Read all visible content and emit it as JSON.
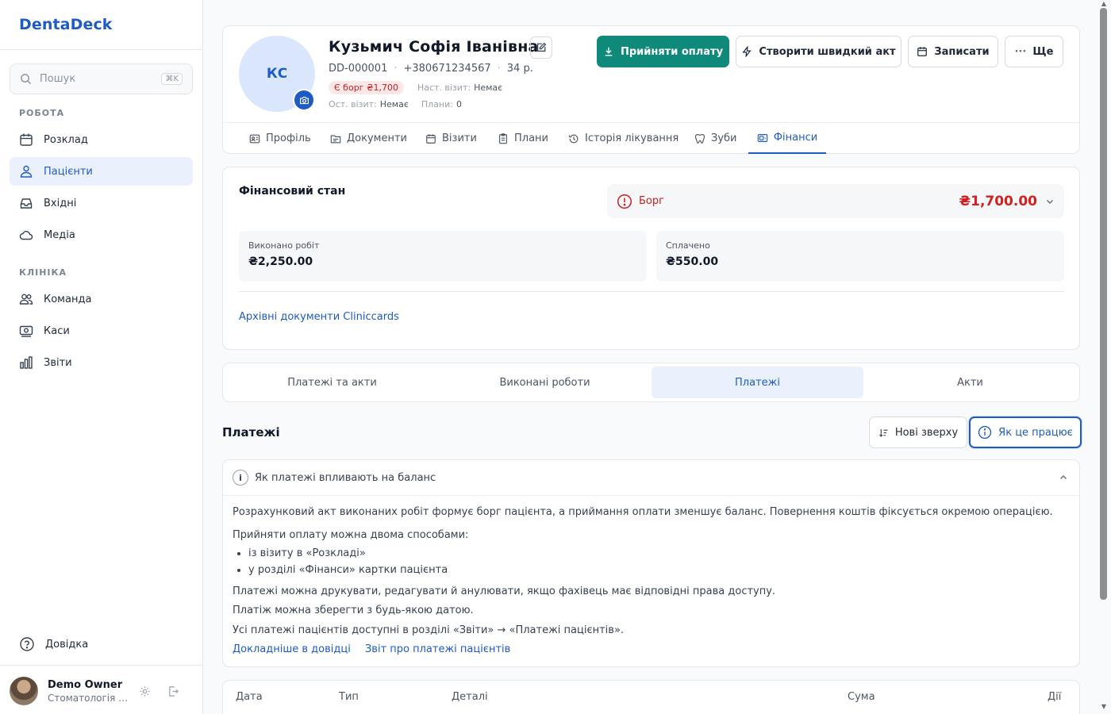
{
  "app": {
    "name": "DentaDeck"
  },
  "search": {
    "placeholder": "Пошук",
    "shortcut": "⌘K"
  },
  "sidebar": {
    "section_work": "РОБОТА",
    "section_clinic": "КЛІНІКА",
    "work_items": [
      {
        "label": "Розклад",
        "icon": "calendar-icon"
      },
      {
        "label": "Пацієнти",
        "icon": "patients-icon",
        "active": true
      },
      {
        "label": "Вхідні",
        "icon": "inbox-icon"
      },
      {
        "label": "Медіа",
        "icon": "cloud-icon"
      }
    ],
    "clinic_items": [
      {
        "label": "Команда",
        "icon": "team-icon"
      },
      {
        "label": "Каси",
        "icon": "cash-icon"
      },
      {
        "label": "Звіти",
        "icon": "reports-icon"
      }
    ],
    "help_label": "Довідка",
    "user": {
      "name": "Demo Owner",
      "org": "Стоматологія П..."
    }
  },
  "patient": {
    "initials": "КС",
    "name": "Кузьмич Софія Іванівна",
    "id": "DD-000001",
    "phone": "+380671234567",
    "age": "34 р.",
    "debt_badge": "Є борг ₴1,700",
    "next_visit_label": "Наст. візит:",
    "next_visit_value": "Немає",
    "last_visit_label": "Ост. візит:",
    "last_visit_value": "Немає",
    "plans_label": "Плани:",
    "plans_value": "0"
  },
  "actions": {
    "accept_payment": "Прийняти оплату",
    "quick_act": "Створити швидкий акт",
    "book": "Записати",
    "more": "Ще"
  },
  "tabs": [
    {
      "label": "Профіль",
      "icon": "profile-icon"
    },
    {
      "label": "Документи",
      "icon": "documents-icon"
    },
    {
      "label": "Візити",
      "icon": "visits-icon"
    },
    {
      "label": "Плани",
      "icon": "plans-icon"
    },
    {
      "label": "Історія лікування",
      "icon": "history-icon"
    },
    {
      "label": "Зуби",
      "icon": "tooth-icon"
    },
    {
      "label": "Фінанси",
      "icon": "finance-icon",
      "active": true
    }
  ],
  "finance": {
    "title": "Фінансовий стан",
    "debt_label": "Борг",
    "debt_amount": "₴1,700.00",
    "works_label": "Виконано робіт",
    "works_value": "₴2,250.00",
    "paid_label": "Сплачено",
    "paid_value": "₴550.00",
    "archive_link": "Архівні документи Cliniccards"
  },
  "segments": [
    {
      "label": "Платежі та акти"
    },
    {
      "label": "Виконані роботи"
    },
    {
      "label": "Платежі",
      "active": true
    },
    {
      "label": "Акти"
    }
  ],
  "payments": {
    "title": "Платежі",
    "sort_label": "Нові зверху",
    "how_label": "Як це працює"
  },
  "info": {
    "title": "Як платежі впливають на баланс",
    "p1": "Розрахунковий акт виконаних робіт формує борг пацієнта, а приймання оплати зменшує баланс. Повернення коштів фіксується окремою операцією.",
    "p2": "Прийняти оплату можна двома способами:",
    "li1": "із візиту в «Розкладі»",
    "li2": "у розділі «Фінанси» картки пацієнта",
    "p3": "Платежі можна друкувати, редагувати й анулювати, якщо фахівець має відповідні права доступу.",
    "p4": "Платіж можна зберегти з будь-якою датою.",
    "p5": "Усі платежі пацієнтів доступні в розділі «Звіти» → «Платежі пацієнтів».",
    "link1": "Докладніше в довідці",
    "link2": "Звіт про платежі пацієнтів"
  },
  "table": {
    "headers": {
      "date": "Дата",
      "type": "Тип",
      "details": "Деталі",
      "amount": "Сума",
      "actions": "Дії"
    }
  },
  "colors": {
    "accent": "#1e5bc6",
    "primary_button": "#0f8a7a",
    "debt": "#d42020"
  }
}
